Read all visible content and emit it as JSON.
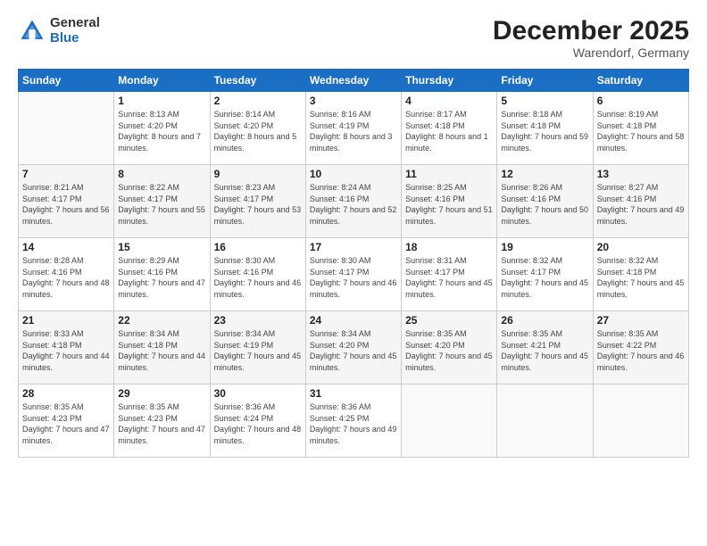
{
  "header": {
    "logo_general": "General",
    "logo_blue": "Blue",
    "month_title": "December 2025",
    "location": "Warendorf, Germany"
  },
  "days_of_week": [
    "Sunday",
    "Monday",
    "Tuesday",
    "Wednesday",
    "Thursday",
    "Friday",
    "Saturday"
  ],
  "weeks": [
    [
      {
        "day": "",
        "sunrise": "",
        "sunset": "",
        "daylight": "",
        "empty": true
      },
      {
        "day": "1",
        "sunrise": "Sunrise: 8:13 AM",
        "sunset": "Sunset: 4:20 PM",
        "daylight": "Daylight: 8 hours and 7 minutes."
      },
      {
        "day": "2",
        "sunrise": "Sunrise: 8:14 AM",
        "sunset": "Sunset: 4:20 PM",
        "daylight": "Daylight: 8 hours and 5 minutes."
      },
      {
        "day": "3",
        "sunrise": "Sunrise: 8:16 AM",
        "sunset": "Sunset: 4:19 PM",
        "daylight": "Daylight: 8 hours and 3 minutes."
      },
      {
        "day": "4",
        "sunrise": "Sunrise: 8:17 AM",
        "sunset": "Sunset: 4:18 PM",
        "daylight": "Daylight: 8 hours and 1 minute."
      },
      {
        "day": "5",
        "sunrise": "Sunrise: 8:18 AM",
        "sunset": "Sunset: 4:18 PM",
        "daylight": "Daylight: 7 hours and 59 minutes."
      },
      {
        "day": "6",
        "sunrise": "Sunrise: 8:19 AM",
        "sunset": "Sunset: 4:18 PM",
        "daylight": "Daylight: 7 hours and 58 minutes."
      }
    ],
    [
      {
        "day": "7",
        "sunrise": "Sunrise: 8:21 AM",
        "sunset": "Sunset: 4:17 PM",
        "daylight": "Daylight: 7 hours and 56 minutes."
      },
      {
        "day": "8",
        "sunrise": "Sunrise: 8:22 AM",
        "sunset": "Sunset: 4:17 PM",
        "daylight": "Daylight: 7 hours and 55 minutes."
      },
      {
        "day": "9",
        "sunrise": "Sunrise: 8:23 AM",
        "sunset": "Sunset: 4:17 PM",
        "daylight": "Daylight: 7 hours and 53 minutes."
      },
      {
        "day": "10",
        "sunrise": "Sunrise: 8:24 AM",
        "sunset": "Sunset: 4:16 PM",
        "daylight": "Daylight: 7 hours and 52 minutes."
      },
      {
        "day": "11",
        "sunrise": "Sunrise: 8:25 AM",
        "sunset": "Sunset: 4:16 PM",
        "daylight": "Daylight: 7 hours and 51 minutes."
      },
      {
        "day": "12",
        "sunrise": "Sunrise: 8:26 AM",
        "sunset": "Sunset: 4:16 PM",
        "daylight": "Daylight: 7 hours and 50 minutes."
      },
      {
        "day": "13",
        "sunrise": "Sunrise: 8:27 AM",
        "sunset": "Sunset: 4:16 PM",
        "daylight": "Daylight: 7 hours and 49 minutes."
      }
    ],
    [
      {
        "day": "14",
        "sunrise": "Sunrise: 8:28 AM",
        "sunset": "Sunset: 4:16 PM",
        "daylight": "Daylight: 7 hours and 48 minutes."
      },
      {
        "day": "15",
        "sunrise": "Sunrise: 8:29 AM",
        "sunset": "Sunset: 4:16 PM",
        "daylight": "Daylight: 7 hours and 47 minutes."
      },
      {
        "day": "16",
        "sunrise": "Sunrise: 8:30 AM",
        "sunset": "Sunset: 4:16 PM",
        "daylight": "Daylight: 7 hours and 46 minutes."
      },
      {
        "day": "17",
        "sunrise": "Sunrise: 8:30 AM",
        "sunset": "Sunset: 4:17 PM",
        "daylight": "Daylight: 7 hours and 46 minutes."
      },
      {
        "day": "18",
        "sunrise": "Sunrise: 8:31 AM",
        "sunset": "Sunset: 4:17 PM",
        "daylight": "Daylight: 7 hours and 45 minutes."
      },
      {
        "day": "19",
        "sunrise": "Sunrise: 8:32 AM",
        "sunset": "Sunset: 4:17 PM",
        "daylight": "Daylight: 7 hours and 45 minutes."
      },
      {
        "day": "20",
        "sunrise": "Sunrise: 8:32 AM",
        "sunset": "Sunset: 4:18 PM",
        "daylight": "Daylight: 7 hours and 45 minutes."
      }
    ],
    [
      {
        "day": "21",
        "sunrise": "Sunrise: 8:33 AM",
        "sunset": "Sunset: 4:18 PM",
        "daylight": "Daylight: 7 hours and 44 minutes."
      },
      {
        "day": "22",
        "sunrise": "Sunrise: 8:34 AM",
        "sunset": "Sunset: 4:18 PM",
        "daylight": "Daylight: 7 hours and 44 minutes."
      },
      {
        "day": "23",
        "sunrise": "Sunrise: 8:34 AM",
        "sunset": "Sunset: 4:19 PM",
        "daylight": "Daylight: 7 hours and 45 minutes."
      },
      {
        "day": "24",
        "sunrise": "Sunrise: 8:34 AM",
        "sunset": "Sunset: 4:20 PM",
        "daylight": "Daylight: 7 hours and 45 minutes."
      },
      {
        "day": "25",
        "sunrise": "Sunrise: 8:35 AM",
        "sunset": "Sunset: 4:20 PM",
        "daylight": "Daylight: 7 hours and 45 minutes."
      },
      {
        "day": "26",
        "sunrise": "Sunrise: 8:35 AM",
        "sunset": "Sunset: 4:21 PM",
        "daylight": "Daylight: 7 hours and 45 minutes."
      },
      {
        "day": "27",
        "sunrise": "Sunrise: 8:35 AM",
        "sunset": "Sunset: 4:22 PM",
        "daylight": "Daylight: 7 hours and 46 minutes."
      }
    ],
    [
      {
        "day": "28",
        "sunrise": "Sunrise: 8:35 AM",
        "sunset": "Sunset: 4:23 PM",
        "daylight": "Daylight: 7 hours and 47 minutes."
      },
      {
        "day": "29",
        "sunrise": "Sunrise: 8:35 AM",
        "sunset": "Sunset: 4:23 PM",
        "daylight": "Daylight: 7 hours and 47 minutes."
      },
      {
        "day": "30",
        "sunrise": "Sunrise: 8:36 AM",
        "sunset": "Sunset: 4:24 PM",
        "daylight": "Daylight: 7 hours and 48 minutes."
      },
      {
        "day": "31",
        "sunrise": "Sunrise: 8:36 AM",
        "sunset": "Sunset: 4:25 PM",
        "daylight": "Daylight: 7 hours and 49 minutes."
      },
      {
        "day": "",
        "sunrise": "",
        "sunset": "",
        "daylight": "",
        "empty": true
      },
      {
        "day": "",
        "sunrise": "",
        "sunset": "",
        "daylight": "",
        "empty": true
      },
      {
        "day": "",
        "sunrise": "",
        "sunset": "",
        "daylight": "",
        "empty": true
      }
    ]
  ]
}
